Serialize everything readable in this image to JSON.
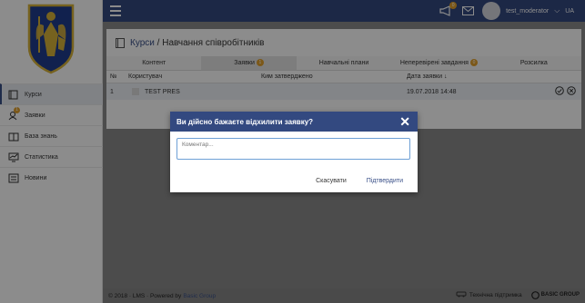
{
  "sidebar": {
    "logo": "kyiv-coat-of-arms",
    "items": [
      {
        "label": "Курси",
        "icon": "book-icon",
        "active": true
      },
      {
        "label": "Заявки",
        "icon": "user-request-icon",
        "badge": "1"
      },
      {
        "label": "База знань",
        "icon": "knowledge-base-icon"
      },
      {
        "label": "Статистика",
        "icon": "statistics-icon"
      },
      {
        "label": "Новини",
        "icon": "news-icon"
      }
    ]
  },
  "topbar": {
    "menu_icon": "hamburger-icon",
    "notification_badge": "0",
    "username": "test_moderator",
    "lang": "UA"
  },
  "page": {
    "breadcrumb_link": "Курси",
    "breadcrumb_sep": " / ",
    "breadcrumb_current": "Навчання співробітників"
  },
  "tabs": [
    {
      "label": "Контент",
      "active": false
    },
    {
      "label": "Заявки",
      "badge": "1",
      "active": true
    },
    {
      "label": "Навчальні плани",
      "active": false
    },
    {
      "label": "Неперевірені завдання",
      "badge": "0",
      "active": false
    },
    {
      "label": "Розсилка",
      "active": false
    }
  ],
  "table": {
    "headers": [
      "№",
      "Користувач",
      "Ким затверджено",
      "Дата заявки ↓"
    ],
    "rows": [
      {
        "num": "1",
        "user": "TEST PRES",
        "approved_by": "",
        "date": "19.07.2018 14:48"
      }
    ]
  },
  "modal": {
    "title": "Ви дійсно бажаєте відхилити заявку?",
    "comment_placeholder": "Коментар...",
    "cancel_label": "Скасувати",
    "confirm_label": "Підтвердити"
  },
  "footer": {
    "copyright": "© 2018 · LMS · Powered by",
    "powered_link": "Basic Group",
    "support": "Технічна підтримка",
    "brand": "BASIC GROUP"
  },
  "colors": {
    "primary": "#334980",
    "badge": "#e2a02c",
    "link": "#3a5088"
  }
}
